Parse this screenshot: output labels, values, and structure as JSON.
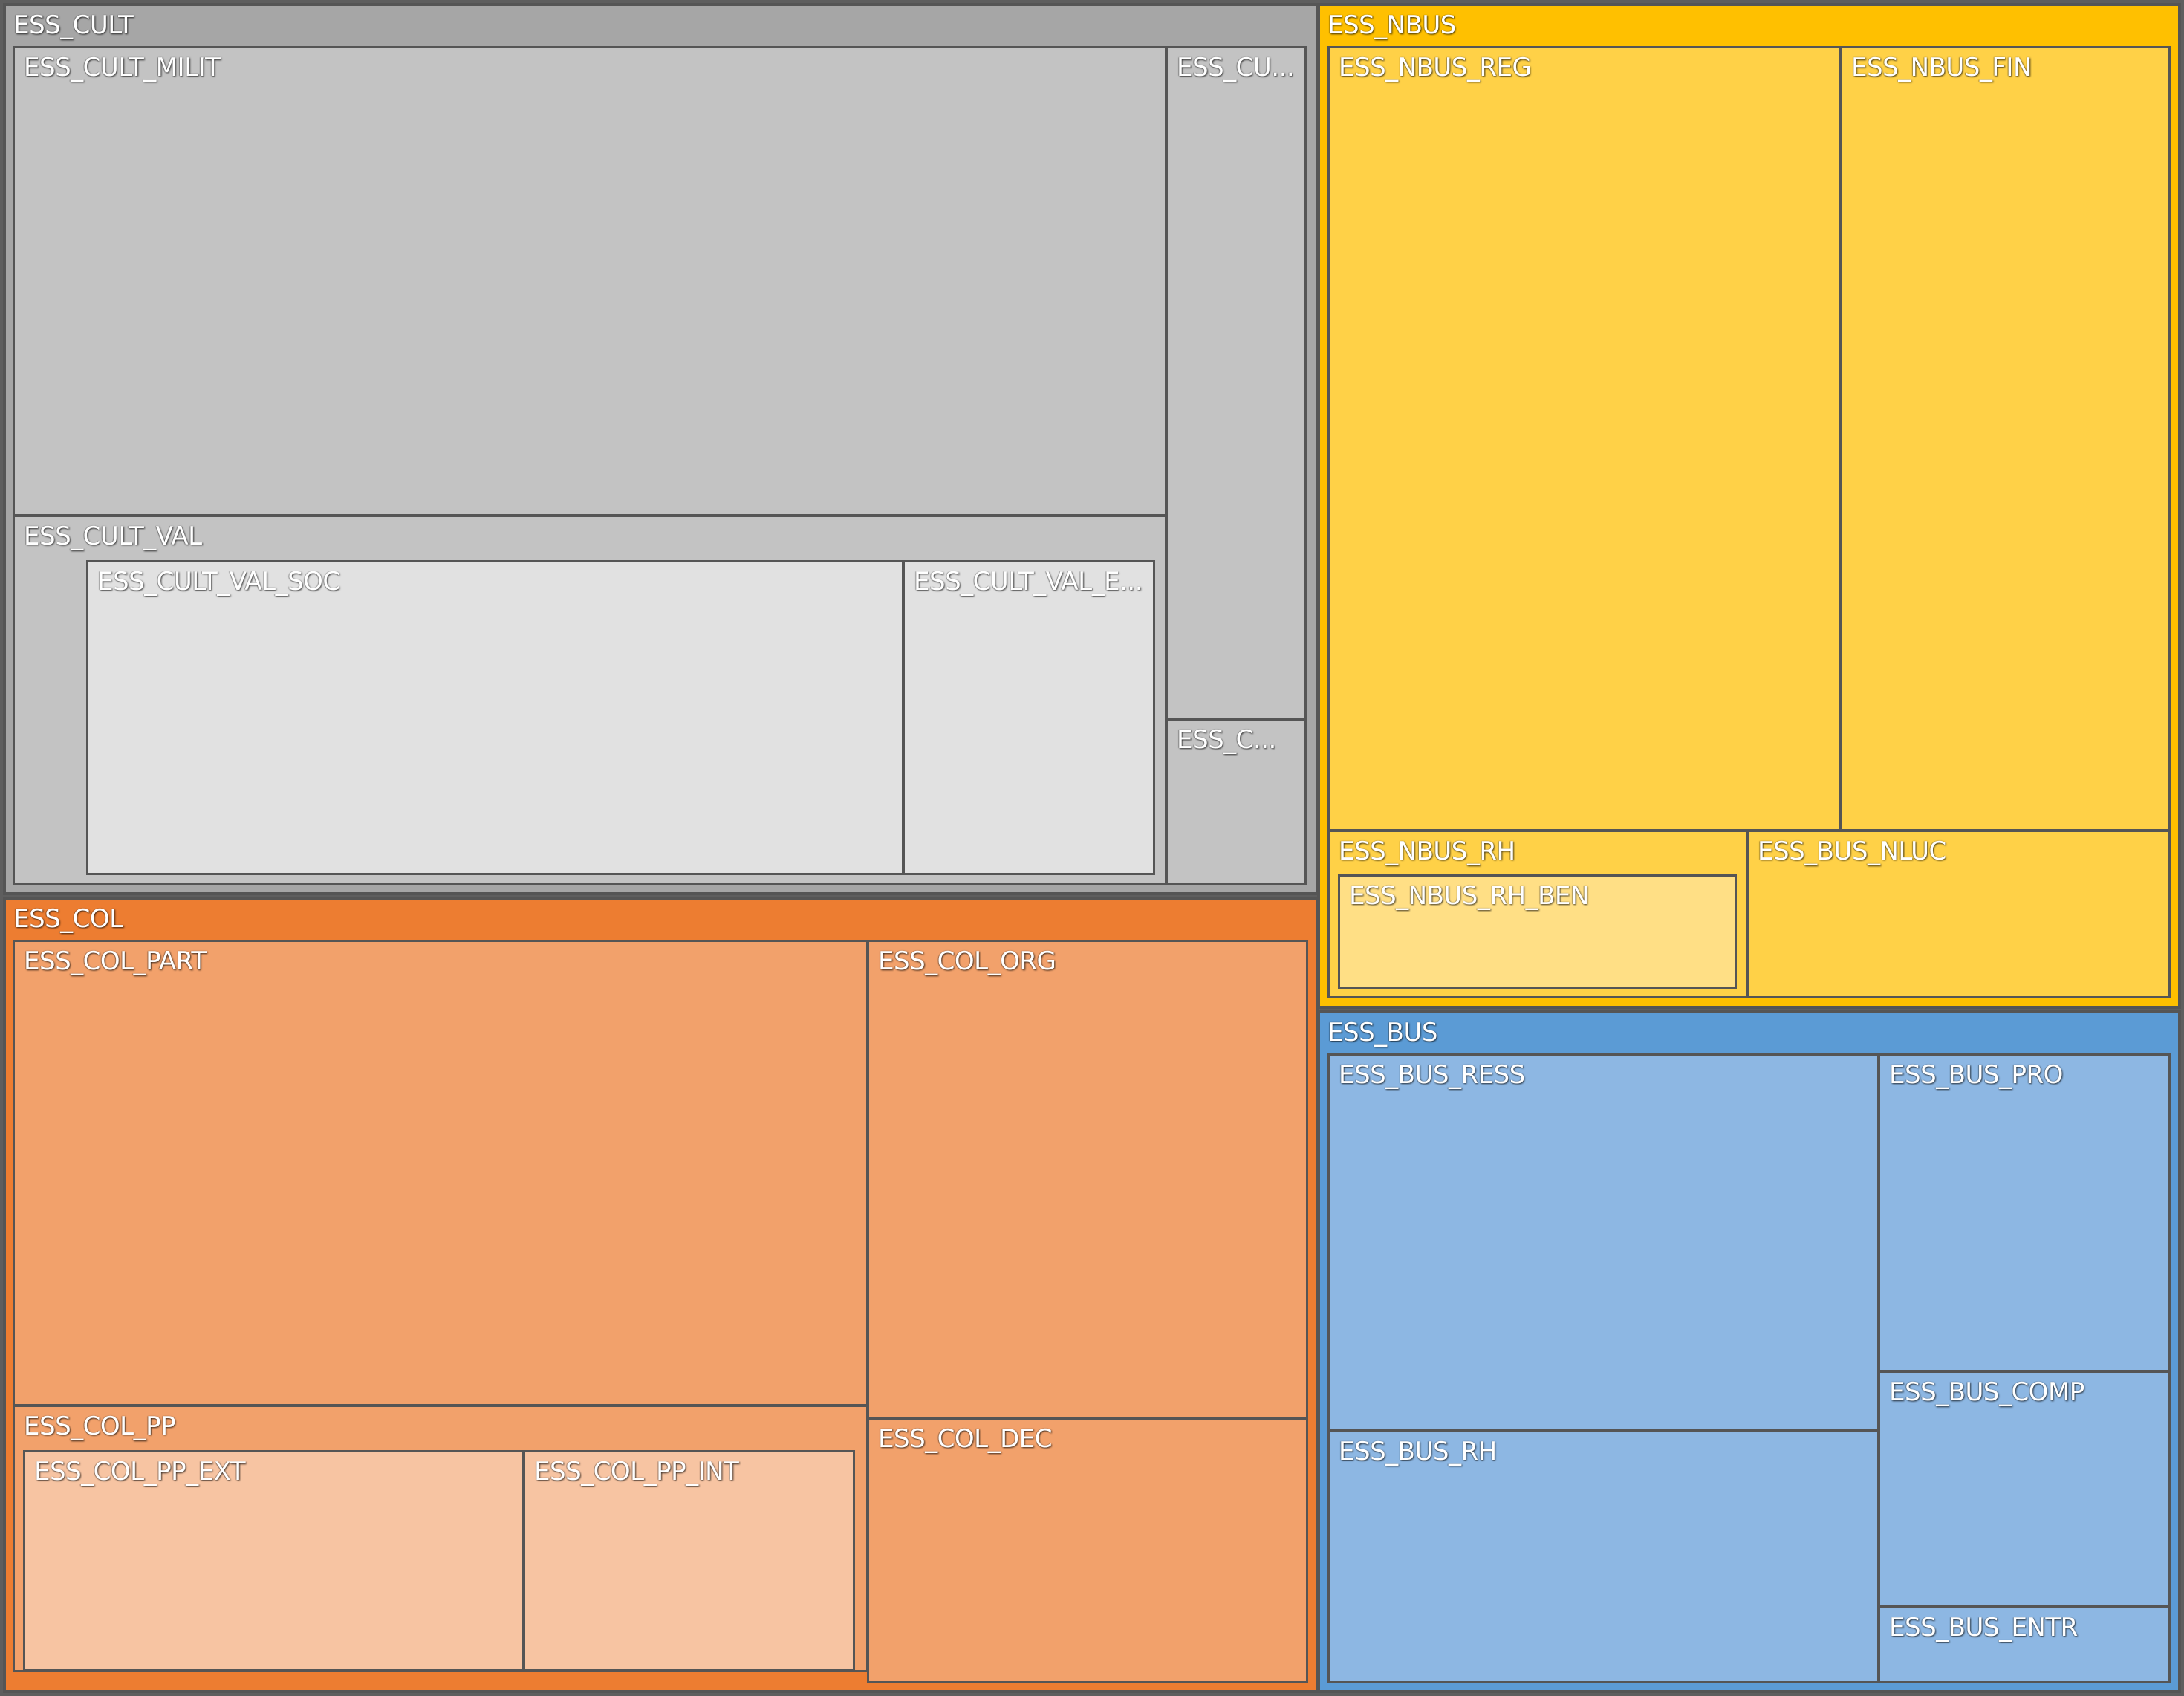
{
  "chart_data": {
    "type": "treemap",
    "title": "",
    "nodes": [
      {
        "id": "cult",
        "label": "ESS_CULT",
        "color": "#a6a6a6",
        "children": [
          {
            "id": "cult_milit",
            "label": "ESS_CULT_MILIT",
            "color": "#c3c3c3"
          },
          {
            "id": "cult_val",
            "label": "ESS_CULT_VAL",
            "color": "#c3c3c3",
            "children": [
              {
                "id": "cult_val_soc",
                "label": "ESS_CULT_VAL_SOC",
                "color": "#e1e1e1"
              },
              {
                "id": "cult_val_e",
                "label": "ESS_CULT_VAL_E...",
                "color": "#e1e1e1"
              }
            ]
          },
          {
            "id": "cult_cu",
            "label": "ESS_CU...",
            "color": "#c3c3c3"
          },
          {
            "id": "cult_c",
            "label": "ESS_C...",
            "color": "#c3c3c3"
          }
        ]
      },
      {
        "id": "nbus",
        "label": "ESS_NBUS",
        "color": "#ffc000",
        "children": [
          {
            "id": "nbus_reg",
            "label": "ESS_NBUS_REG",
            "color": "#ffd147"
          },
          {
            "id": "nbus_fin",
            "label": "ESS_NBUS_FIN",
            "color": "#ffd147"
          },
          {
            "id": "nbus_rh",
            "label": "ESS_NBUS_RH",
            "color": "#ffd147",
            "children": [
              {
                "id": "nbus_rh_ben",
                "label": "ESS_NBUS_RH_BEN",
                "color": "#ffdf85"
              }
            ]
          },
          {
            "id": "bus_nluc",
            "label": "ESS_BUS_NLUC",
            "color": "#ffd147"
          }
        ]
      },
      {
        "id": "col",
        "label": "ESS_COL",
        "color": "#ed7d31",
        "children": [
          {
            "id": "col_part",
            "label": "ESS_COL_PART",
            "color": "#f2a16b"
          },
          {
            "id": "col_pp",
            "label": "ESS_COL_PP",
            "color": "#f2a16b",
            "children": [
              {
                "id": "col_pp_ext",
                "label": "ESS_COL_PP_EXT",
                "color": "#f7c4a2"
              },
              {
                "id": "col_pp_int",
                "label": "ESS_COL_PP_INT",
                "color": "#f7c4a2"
              }
            ]
          },
          {
            "id": "col_org",
            "label": "ESS_COL_ORG",
            "color": "#f2a16b"
          },
          {
            "id": "col_dec",
            "label": "ESS_COL_DEC",
            "color": "#f2a16b"
          }
        ]
      },
      {
        "id": "bus",
        "label": "ESS_BUS",
        "color": "#5b9bd5",
        "children": [
          {
            "id": "bus_ress",
            "label": "ESS_BUS_RESS",
            "color": "#8db7e3"
          },
          {
            "id": "bus_rh",
            "label": "ESS_BUS_RH",
            "color": "#8db7e3"
          },
          {
            "id": "bus_pro",
            "label": "ESS_BUS_PRO",
            "color": "#8db7e3"
          },
          {
            "id": "bus_comp",
            "label": "ESS_BUS_COMP",
            "color": "#8db7e3"
          },
          {
            "id": "bus_entr",
            "label": "ESS_BUS_ENTR",
            "color": "#8db7e3"
          }
        ]
      }
    ]
  }
}
